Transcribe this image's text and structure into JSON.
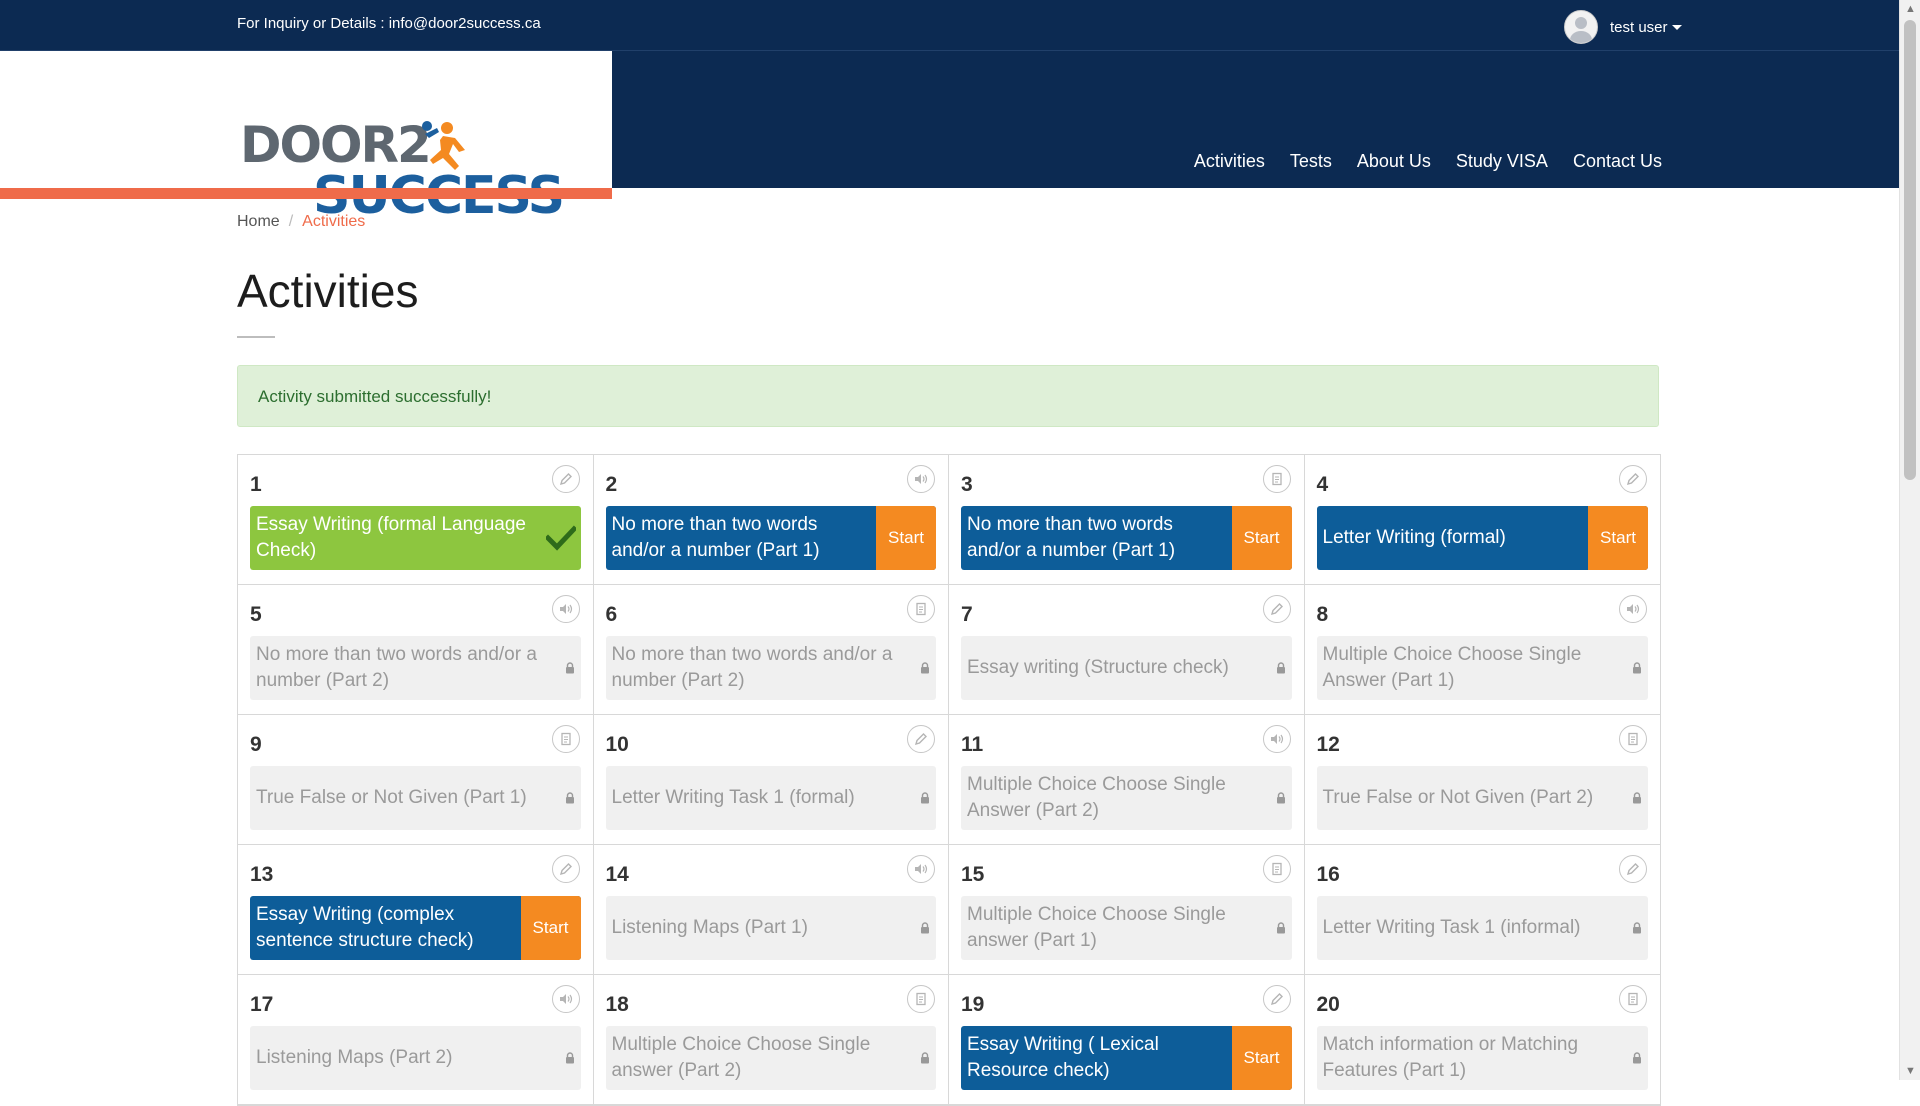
{
  "topbar": {
    "inquiry": "For Inquiry or Details : info@door2success.ca",
    "user_name": "test user"
  },
  "logo": {
    "line1": "DOOR2",
    "line2": "SUCCESS"
  },
  "nav": [
    "Activities",
    "Tests",
    "About Us",
    "Study VISA",
    "Contact Us"
  ],
  "breadcrumb": {
    "home": "Home",
    "sep": "/",
    "current": "Activities"
  },
  "page_title": "Activities",
  "alert": "Activity submitted successfully!",
  "start_label": "Start",
  "activities": [
    {
      "num": "1",
      "title": "Essay Writing (formal Language Check)",
      "state": "completed",
      "icon": "pencil-icon"
    },
    {
      "num": "2",
      "title": "No more than two words and/or a number (Part 1)",
      "state": "available",
      "icon": "speaker-icon"
    },
    {
      "num": "3",
      "title": "No more than two words and/or a number (Part 1)",
      "state": "available",
      "icon": "document-icon"
    },
    {
      "num": "4",
      "title": "Letter Writing (formal)",
      "state": "available",
      "icon": "pencil-icon"
    },
    {
      "num": "5",
      "title": "No more than two words and/or a number (Part 2)",
      "state": "locked",
      "icon": "speaker-icon"
    },
    {
      "num": "6",
      "title": "No more than two words and/or a number (Part 2)",
      "state": "locked",
      "icon": "document-icon"
    },
    {
      "num": "7",
      "title": "Essay writing (Structure check)",
      "state": "locked",
      "icon": "pencil-icon"
    },
    {
      "num": "8",
      "title": "Multiple Choice Choose Single Answer (Part 1)",
      "state": "locked",
      "icon": "speaker-icon"
    },
    {
      "num": "9",
      "title": "True False or Not Given (Part 1)",
      "state": "locked",
      "icon": "document-icon"
    },
    {
      "num": "10",
      "title": "Letter Writing Task 1 (formal)",
      "state": "locked",
      "icon": "pencil-icon"
    },
    {
      "num": "11",
      "title": "Multiple Choice Choose Single Answer (Part 2)",
      "state": "locked",
      "icon": "speaker-icon"
    },
    {
      "num": "12",
      "title": "True False or Not Given (Part 2)",
      "state": "locked",
      "icon": "document-icon"
    },
    {
      "num": "13",
      "title": "Essay Writing (complex sentence structure check)",
      "state": "available",
      "icon": "pencil-icon"
    },
    {
      "num": "14",
      "title": "Listening Maps (Part 1)",
      "state": "locked",
      "icon": "speaker-icon"
    },
    {
      "num": "15",
      "title": "Multiple Choice Choose Single answer (Part 1)",
      "state": "locked",
      "icon": "document-icon"
    },
    {
      "num": "16",
      "title": "Letter Writing Task 1 (informal)",
      "state": "locked",
      "icon": "pencil-icon"
    },
    {
      "num": "17",
      "title": "Listening Maps (Part 2)",
      "state": "locked",
      "icon": "speaker-icon"
    },
    {
      "num": "18",
      "title": "Multiple Choice Choose Single answer (Part 2)",
      "state": "locked",
      "icon": "document-icon"
    },
    {
      "num": "19",
      "title": "Essay Writing ( Lexical Resource check)",
      "state": "available",
      "icon": "pencil-icon"
    },
    {
      "num": "20",
      "title": "Match information or Matching Features (Part 1)",
      "state": "locked",
      "icon": "document-icon"
    }
  ],
  "colors": {
    "navy": "#0c2a52",
    "accent": "#ef6b4a",
    "completed": "#8dc63f",
    "available": "#0d5d99",
    "start": "#f48a21"
  }
}
